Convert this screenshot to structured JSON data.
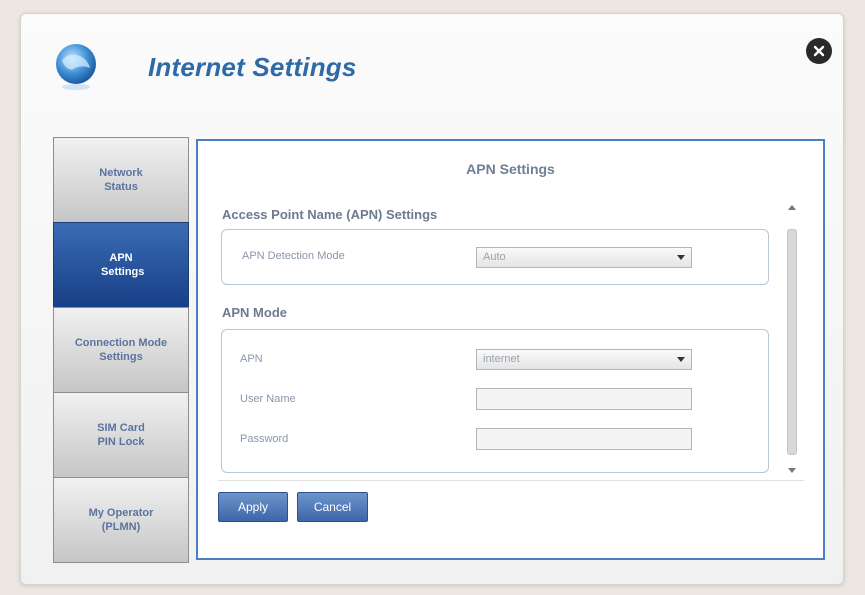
{
  "window": {
    "title": "Internet Settings"
  },
  "sidebar": {
    "items": [
      {
        "label": "Network Status",
        "active": false
      },
      {
        "label": "APN Settings",
        "active": true
      },
      {
        "label": "Connection Mode Settings",
        "active": false
      },
      {
        "label": "SIM Card PIN Lock",
        "active": false
      },
      {
        "label": "My Operator (PLMN)",
        "active": false
      }
    ]
  },
  "panel": {
    "title": "APN Settings",
    "apn_section": {
      "title": "Access Point Name (APN) Settings",
      "detection_mode_label": "APN Detection Mode",
      "detection_mode_value": "Auto"
    },
    "apn_mode": {
      "title": "APN Mode",
      "apn_label": "APN",
      "apn_value": "internet",
      "username_label": "User Name",
      "username_value": "",
      "password_label": "Password",
      "password_value": ""
    },
    "buttons": {
      "apply": "Apply",
      "cancel": "Cancel"
    }
  },
  "icons": {
    "app": "globe-icon",
    "close": "close-icon",
    "dropdown": "chevron-down-icon"
  },
  "colors": {
    "accent": "#2f6aa8",
    "active_tab": "#1f4d96",
    "panel_border": "#4a7fc4"
  }
}
